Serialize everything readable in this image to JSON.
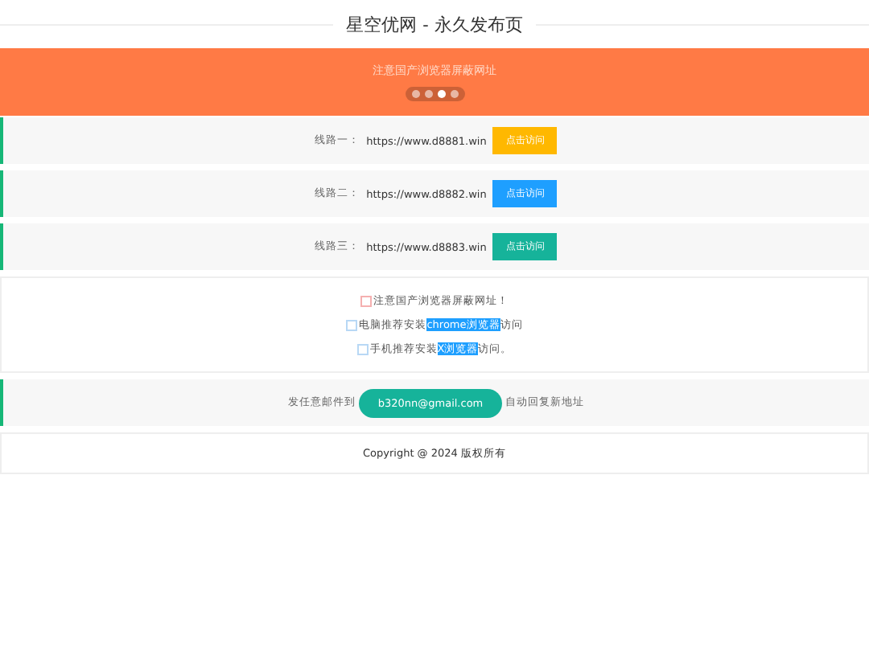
{
  "title": "星空优网 - 永久发布页",
  "banner": {
    "text": "注意国产浏览器屏蔽网址",
    "dots": [
      {
        "selected": false
      },
      {
        "selected": false
      },
      {
        "selected": true
      },
      {
        "selected": false
      }
    ]
  },
  "lines": [
    {
      "label": "线路一：",
      "url": "https://www.d8881.win",
      "button": "点击访问",
      "color": "#ffb800"
    },
    {
      "label": "线路二：",
      "url": "https://www.d8882.win",
      "button": "点击访问",
      "color": "#1e9fff"
    },
    {
      "label": "线路三：",
      "url": "https://www.d8883.win",
      "button": "点击访问",
      "color": "#16b39a"
    }
  ],
  "tips": [
    {
      "parts": [
        {
          "text": "注意国产浏览器屏蔽网址！",
          "highlight": false
        }
      ]
    },
    {
      "parts": [
        {
          "text": "电脑推荐安装",
          "highlight": false
        },
        {
          "text": "chrome浏览器",
          "highlight": true
        },
        {
          "text": "访问",
          "highlight": false
        }
      ]
    },
    {
      "parts": [
        {
          "text": "手机推荐安装",
          "highlight": false
        },
        {
          "text": "X浏览器",
          "highlight": true
        },
        {
          "text": "访问。",
          "highlight": false
        }
      ]
    }
  ],
  "email": {
    "before": "发任意邮件到",
    "address": "b320nn@gmail.com",
    "after": "自动回复新地址"
  },
  "footer": "Copyright @ 2024 版权所有"
}
